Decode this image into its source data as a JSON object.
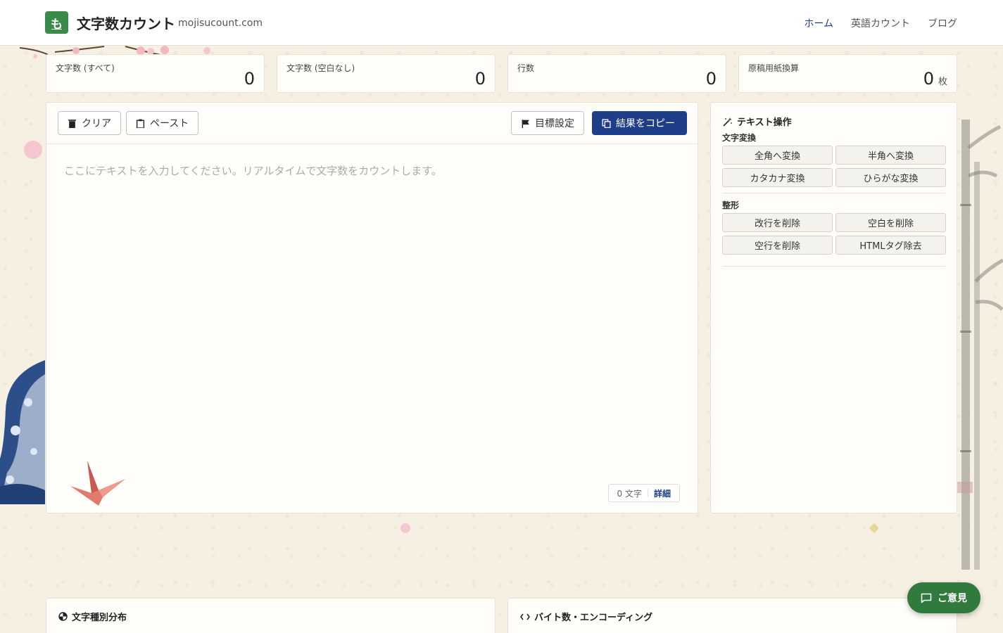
{
  "header": {
    "logo_char": "も",
    "title": "文字数カウント",
    "domain": "mojisucount.com",
    "nav": [
      {
        "label": "ホーム",
        "active": true
      },
      {
        "label": "英語カウント",
        "active": false
      },
      {
        "label": "ブログ",
        "active": false
      }
    ]
  },
  "stats": [
    {
      "label": "文字数 (すべて)",
      "value": "0",
      "unit": ""
    },
    {
      "label": "文字数 (空白なし)",
      "value": "0",
      "unit": ""
    },
    {
      "label": "行数",
      "value": "0",
      "unit": ""
    },
    {
      "label": "原稿用紙換算",
      "value": "0",
      "unit": "枚"
    }
  ],
  "editor": {
    "clear_label": "クリア",
    "paste_label": "ペースト",
    "goal_label": "目標設定",
    "copy_label": "結果をコピー",
    "placeholder": "ここにテキストを入力してください。リアルタイムで文字数をカウントします。",
    "counter": "0 文字",
    "detail_label": "詳細"
  },
  "side": {
    "title": "テキスト操作",
    "sections": [
      {
        "label": "文字変換",
        "ops": [
          "全角へ変換",
          "半角へ変換",
          "カタカナ変換",
          "ひらがな変換"
        ]
      },
      {
        "label": "整形",
        "ops": [
          "改行を削除",
          "空白を削除",
          "空行を削除",
          "HTMLタグ除去"
        ]
      }
    ]
  },
  "bottom": {
    "distribution_title": "文字種別分布",
    "bytes_title": "バイト数・エンコーディング"
  },
  "feedback_label": "ご意見",
  "colors": {
    "accent": "#1e3e8a",
    "brand_green": "#3a8a4a",
    "feedback_green": "#2f7a3c"
  }
}
